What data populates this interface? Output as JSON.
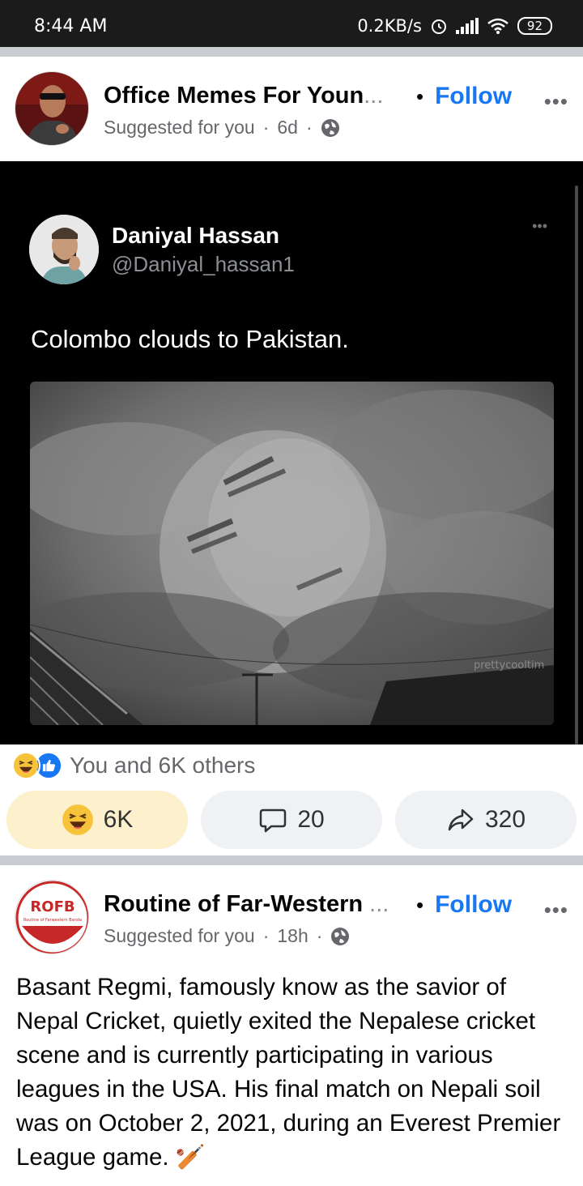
{
  "status_bar": {
    "time": "8:44 AM",
    "net_speed": "0.2KB/s",
    "battery": "92",
    "icons": [
      "alarm-icon",
      "signal-icon",
      "wifi-icon",
      "battery-icon"
    ]
  },
  "post1": {
    "page_name": "Office Memes For Youn",
    "name_ellipsis": "...",
    "dot": "•",
    "follow_label": "Follow",
    "more": "•••",
    "suggested": "Suggested for you",
    "sep": "·",
    "age": "6d",
    "tweet": {
      "name": "Daniyal Hassan",
      "handle": "@Daniyal_hassan1",
      "more": "•••",
      "text": "Colombo clouds to Pakistan.",
      "watermark": "prettycooltim"
    },
    "reactions_text": "You and 6K others",
    "react_count": "6K",
    "comment_count": "20",
    "share_count": "320"
  },
  "post2": {
    "page_name": "Routine of Far-Western",
    "name_ellipsis": " ...",
    "dot": "•",
    "follow_label": "Follow",
    "more": "•••",
    "suggested": "Suggested for you",
    "sep": "·",
    "age": "18h",
    "logo_text": "ROFB",
    "logo_sub": "Routine of Farwestern Banda",
    "body": "Basant Regmi, famously know as the savior of Nepal Cricket, quietly exited the Nepalese cricket scene and is currently participating in various leagues in the USA. His final match on Nepali soil was on October 2, 2021, during an Everest Premier League game. 🏏"
  },
  "colors": {
    "accent": "#1877f2",
    "react_bg": "#fdf0cc",
    "button_bg": "#eff1f4",
    "separator": "#c9ccd1"
  }
}
